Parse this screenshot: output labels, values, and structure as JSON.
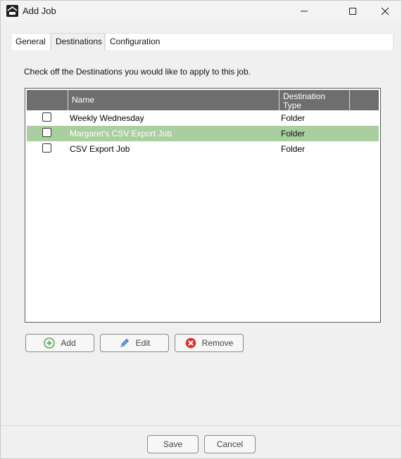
{
  "window": {
    "title": "Add Job",
    "icon": "app-logo-icon"
  },
  "tabs": [
    {
      "label": "General"
    },
    {
      "label": "Destinations",
      "selected": true
    },
    {
      "label": "Configuration"
    }
  ],
  "instructions": "Check off the Destinations you would like to apply to this job.",
  "grid": {
    "columns": [
      "",
      "Name",
      "Destination\nType",
      ""
    ],
    "col_name": "Name",
    "col_type_line1": "Destination",
    "col_type_line2": "Type",
    "rows": [
      {
        "checked": false,
        "name": "Weekly Wednesday",
        "type": "Folder"
      },
      {
        "checked": false,
        "name": "Margaret's CSV Export Job",
        "type": "Folder",
        "selected": true
      },
      {
        "checked": false,
        "name": "CSV Export Job",
        "type": "Folder"
      }
    ],
    "selected_row_color": "#a9cf9f"
  },
  "actions": {
    "add": "Add",
    "edit": "Edit",
    "remove": "Remove"
  },
  "footer": {
    "save": "Save",
    "cancel": "Cancel"
  },
  "colors": {
    "add_icon": "#5aa55a",
    "edit_icon": "#3b7fd1",
    "remove_icon": "#d9342b",
    "header_bg": "#6e6e6e"
  }
}
